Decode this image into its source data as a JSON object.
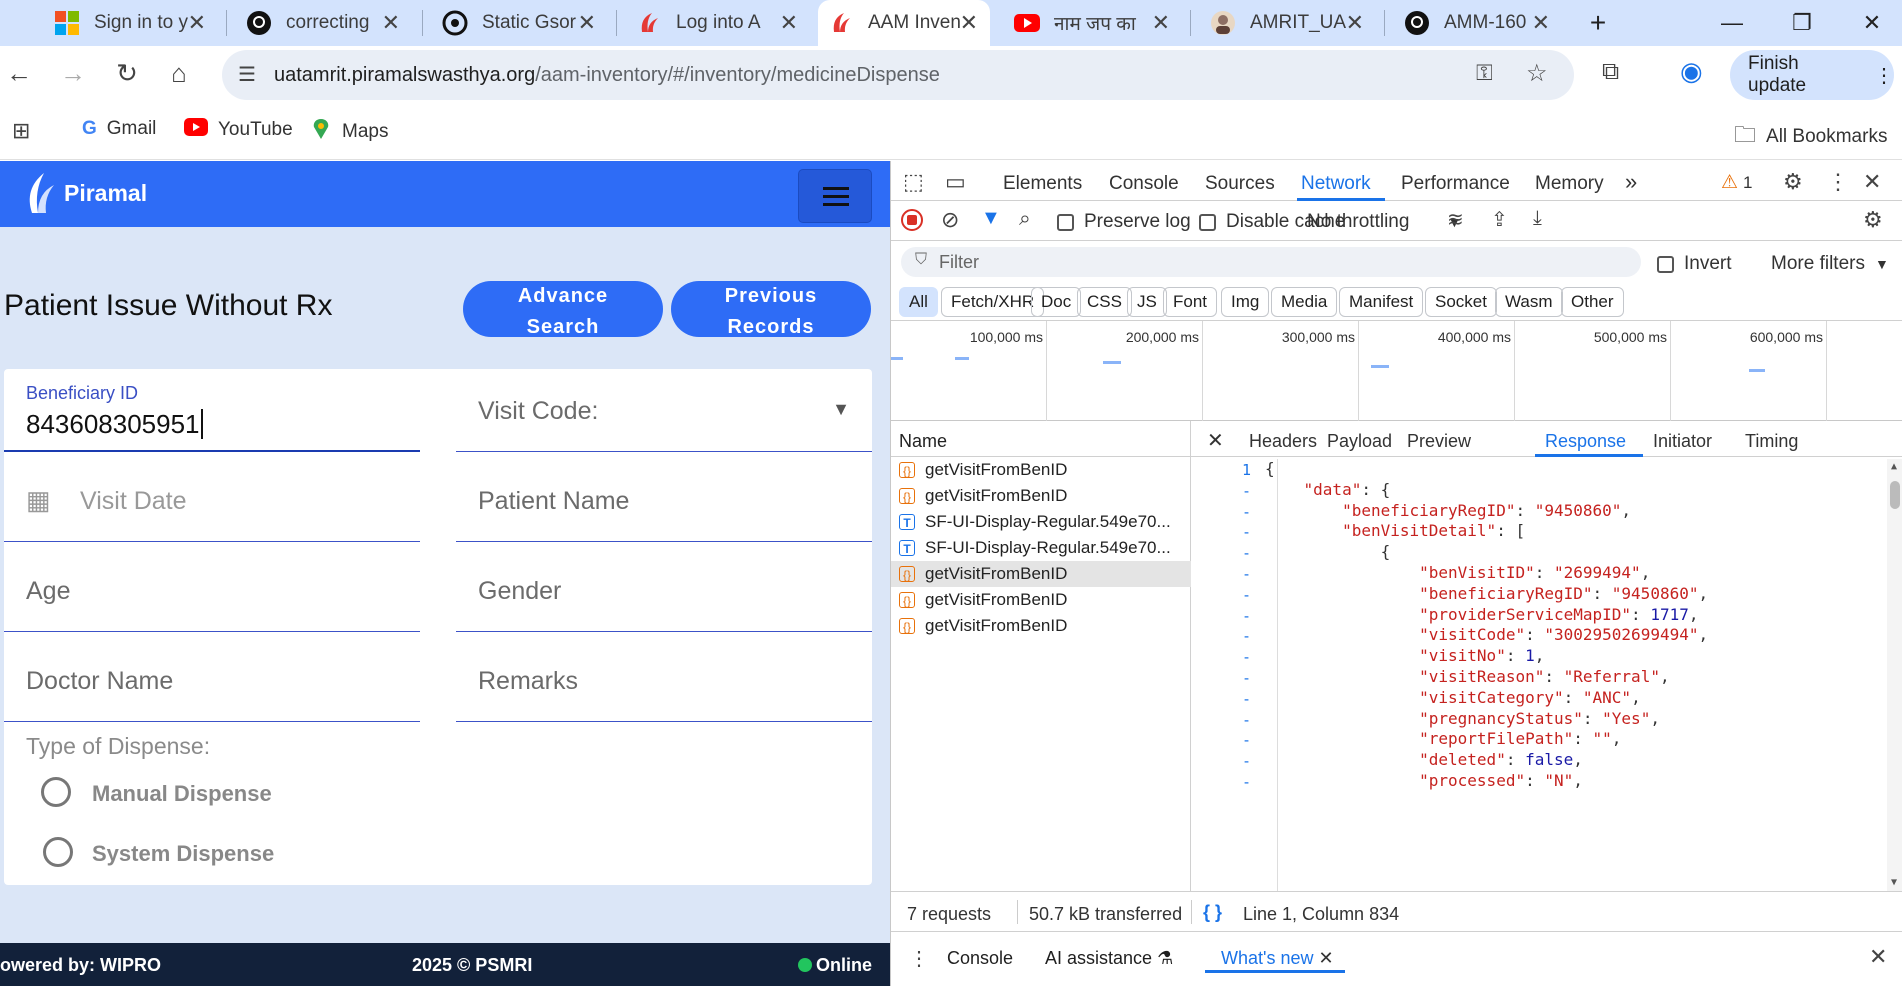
{
  "browser": {
    "tabs": [
      {
        "label": "Sign in to y",
        "icon": "microsoft-icon"
      },
      {
        "label": "correcting",
        "icon": "github-icon"
      },
      {
        "label": "Static Gsor",
        "icon": "chatgpt-icon"
      },
      {
        "label": "Log into A",
        "icon": "piramal-icon"
      },
      {
        "label": "AAM Inven",
        "icon": "piramal-icon"
      },
      {
        "label": "नाम जप का",
        "icon": "youtube-icon"
      },
      {
        "label": "AMRIT_UA",
        "icon": "avatar-icon"
      },
      {
        "label": "AMM-160",
        "icon": "github-icon"
      }
    ],
    "url_domain": "uatamrit.piramalswasthya.org",
    "url_path": "/aam-inventory/#/inventory/medicineDispense",
    "finish_update": "Finish update",
    "bookmarks": [
      "Gmail",
      "YouTube",
      "Maps"
    ],
    "all_bookmarks": "All Bookmarks"
  },
  "app": {
    "logo_text": "Piramal",
    "page_title": "Patient Issue Without Rx",
    "advance_search": [
      "Advance",
      "Search"
    ],
    "previous_records": [
      "Previous",
      "Records"
    ],
    "form": {
      "beneficiary_label": "Beneficiary ID",
      "beneficiary_value": "843608305951",
      "visit_code": "Visit Code:",
      "visit_date": "Visit Date",
      "patient_name": "Patient Name",
      "age": "Age",
      "gender": "Gender",
      "doctor_name": "Doctor Name",
      "remarks": "Remarks",
      "dispense_type": "Type of Dispense:",
      "manual": "Manual Dispense",
      "system": "System Dispense"
    },
    "footer": {
      "left": "owered by: WIPRO",
      "center": "2025 © PSMRI",
      "right": "Online"
    }
  },
  "devtools": {
    "tabs": [
      "Elements",
      "Console",
      "Sources",
      "Network",
      "Performance",
      "Memory"
    ],
    "active_tab": "Network",
    "warning_count": "1",
    "preserve_log": "Preserve log",
    "disable_cache": "Disable cache",
    "throttling": "No throttling",
    "filter_placeholder": "Filter",
    "invert": "Invert",
    "more_filters": "More filters",
    "type_filters": [
      "All",
      "Fetch/XHR",
      "Doc",
      "CSS",
      "JS",
      "Font",
      "Img",
      "Media",
      "Manifest",
      "Socket",
      "Wasm",
      "Other"
    ],
    "timeline_labels": [
      "100,000 ms",
      "200,000 ms",
      "300,000 ms",
      "400,000 ms",
      "500,000 ms",
      "600,000 ms"
    ],
    "name_header": "Name",
    "requests": [
      {
        "name": "getVisitFromBenID",
        "type": "json"
      },
      {
        "name": "getVisitFromBenID",
        "type": "json"
      },
      {
        "name": "SF-UI-Display-Regular.549e70...",
        "type": "font"
      },
      {
        "name": "SF-UI-Display-Regular.549e70...",
        "type": "font"
      },
      {
        "name": "getVisitFromBenID",
        "type": "json",
        "selected": true
      },
      {
        "name": "getVisitFromBenID",
        "type": "json"
      },
      {
        "name": "getVisitFromBenID",
        "type": "json"
      }
    ],
    "detail_tabs": [
      "Headers",
      "Payload",
      "Preview",
      "Response",
      "Initiator",
      "Timing"
    ],
    "active_detail_tab": "Response",
    "response_lines": [
      "{",
      "    \"data\": {",
      "        \"beneficiaryRegID\": \"9450860\",",
      "        \"benVisitDetail\": [",
      "            {",
      "                \"benVisitID\": \"2699494\",",
      "                \"beneficiaryRegID\": \"9450860\",",
      "                \"providerServiceMapID\": 1717,",
      "                \"visitCode\": \"30029502699494\",",
      "                \"visitNo\": 1,",
      "                \"visitReason\": \"Referral\",",
      "                \"visitCategory\": \"ANC\",",
      "                \"pregnancyStatus\": \"Yes\",",
      "                \"reportFilePath\": \"\",",
      "                \"deleted\": false,",
      "                \"processed\": \"N\","
    ],
    "status": {
      "requests": "7 requests",
      "transferred": "50.7 kB transferred",
      "position": "Line 1, Column 834"
    },
    "drawer_tabs": [
      "Console",
      "AI assistance",
      "What's new"
    ]
  }
}
